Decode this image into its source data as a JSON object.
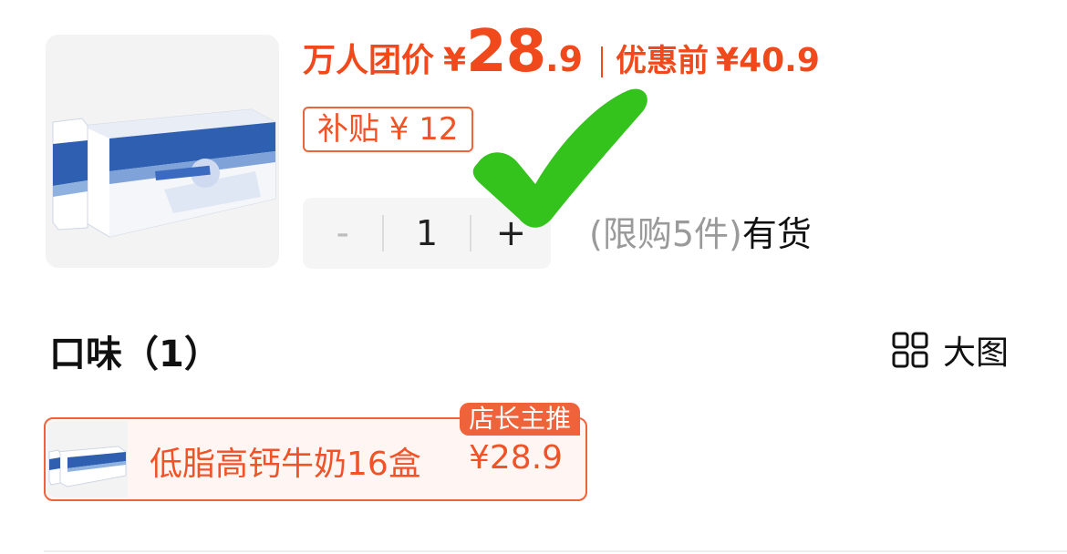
{
  "product": {
    "image_icon": "milk-carton-box-image"
  },
  "price": {
    "group_label": "万人团价",
    "currency": "¥",
    "integer": "28",
    "decimal": ".9",
    "original_label": "优惠前",
    "original_value": "¥40.9",
    "accent_color": "#f04a1c"
  },
  "subsidy": {
    "label": "补贴 ¥ 12"
  },
  "quantity": {
    "minus_label": "-",
    "value": "1",
    "plus_label": "+"
  },
  "stock": {
    "limit_text": "(限购5件)",
    "status_text": "有货"
  },
  "flavor": {
    "title": "口味（1）",
    "big_image_label": "大图",
    "big_image_icon": "grid-icon"
  },
  "variants": [
    {
      "name": "低脂高钙牛奶16盒",
      "price": "¥28.9",
      "badge": "店长主推",
      "selected": true
    }
  ],
  "overlay": {
    "icon": "green-check-mark-icon",
    "color": "#34c21c"
  }
}
